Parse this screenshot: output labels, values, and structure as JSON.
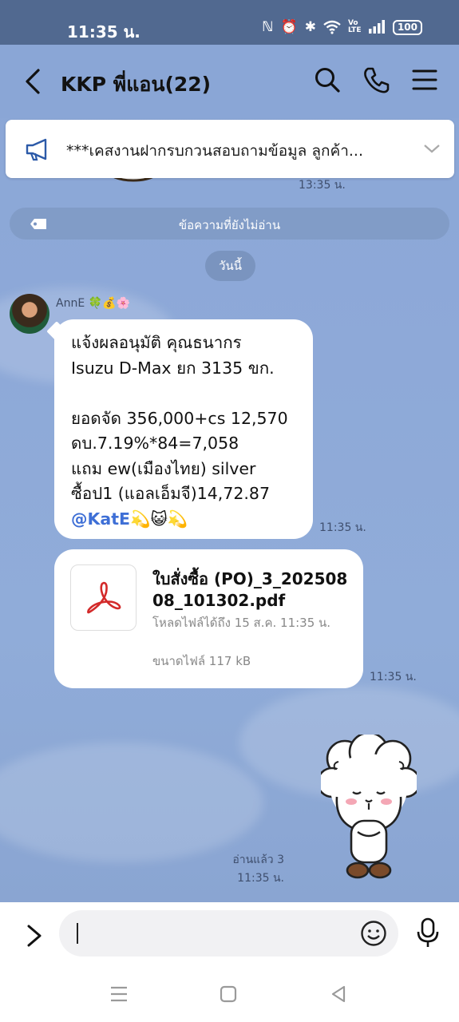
{
  "status_bar": {
    "time": "11:35 น.",
    "battery": "100",
    "net_label": "Vo LTE"
  },
  "header": {
    "title": "KKP พี่แอน(22)",
    "icons": [
      "back-icon",
      "search-icon",
      "phone-icon",
      "menu-icon"
    ]
  },
  "announcement": {
    "text": "***เคสงานฝากรบกวนสอบถามข้อมูล ลูกค้า..."
  },
  "timeline": {
    "earlier_time": "13:35 น.",
    "unread_label": "ข้อความที่ยังไม่อ่าน",
    "date_label": "วันนี้"
  },
  "messages": {
    "sender_name": "AnnE 🍀💰🌸",
    "text_lines": [
      "แจ้งผลอนุมัติ คุณธนากร",
      "Isuzu D-Max ยก 3135 ขก.",
      "",
      "ยอดจัด 356,000+cs 12,570",
      "ดบ.7.19%*84=7,058",
      "แถม ew(เมืองไทย) silver",
      "ซื้อป1 (แอลเอ็มจี)14,72.87"
    ],
    "mention": "@KatE",
    "mention_emoji": "💫😺💫",
    "text_time": "11:35 น.",
    "file": {
      "name": "ใบสั่งซื้อ (PO)_3_20250808_101302.pdf",
      "expire": "โหลดไฟล์ได้ถึง 15 ส.ค. 11:35 น.",
      "size": "ขนาดไฟล์ 117 kB",
      "time": "11:35 น."
    },
    "read_label": "อ่านแล้ว 3",
    "sticker_time": "11:35 น."
  },
  "input": {
    "value": "",
    "placeholder": ""
  }
}
